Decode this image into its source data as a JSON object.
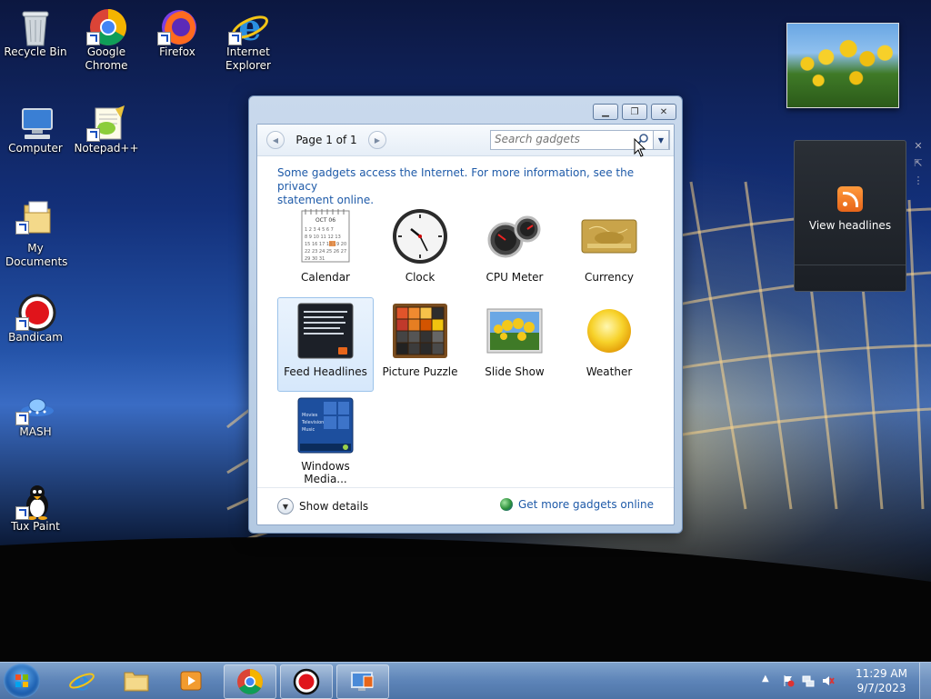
{
  "desktop": {
    "icons": [
      {
        "label": "Recycle Bin",
        "icon": "recycle-bin-icon"
      },
      {
        "label": "Google Chrome",
        "icon": "chrome-icon"
      },
      {
        "label": "Firefox",
        "icon": "firefox-icon"
      },
      {
        "label": "Internet Explorer",
        "icon": "internet-explorer-icon"
      },
      {
        "label": "Computer",
        "icon": "computer-icon"
      },
      {
        "label": "Notepad++",
        "icon": "notepad-plus-plus-icon"
      },
      {
        "label": "My Documents",
        "icon": "folder-icon"
      },
      {
        "label": "Bandicam",
        "icon": "bandicam-icon"
      },
      {
        "label": "MASH",
        "icon": "mash-icon"
      },
      {
        "label": "Tux Paint",
        "icon": "tux-paint-icon"
      }
    ]
  },
  "gadget_window": {
    "pager": {
      "text": "Page 1 of 1"
    },
    "search": {
      "placeholder": "Search gadgets"
    },
    "info_line1": "Some gadgets access the Internet.  For more information, see the privacy",
    "info_line2": "statement online.",
    "gadgets": [
      {
        "label": "Calendar",
        "icon": "calendar-icon"
      },
      {
        "label": "Clock",
        "icon": "clock-icon"
      },
      {
        "label": "CPU Meter",
        "icon": "cpu-meter-icon"
      },
      {
        "label": "Currency",
        "icon": "currency-icon"
      },
      {
        "label": "Feed Headlines",
        "icon": "feed-headlines-icon",
        "selected": true
      },
      {
        "label": "Picture Puzzle",
        "icon": "picture-puzzle-icon"
      },
      {
        "label": "Slide Show",
        "icon": "slide-show-icon"
      },
      {
        "label": "Weather",
        "icon": "weather-icon"
      },
      {
        "label": "Windows Media...",
        "icon": "windows-media-center-icon"
      }
    ],
    "calendar_month": "OCT 06",
    "media_center_items": [
      "Movies",
      "Television",
      "Music"
    ],
    "footer": {
      "show_details": "Show details",
      "get_more": "Get more gadgets online"
    }
  },
  "feed_gadget": {
    "label": "View headlines"
  },
  "taskbar": {
    "buttons": [
      {
        "icon": "internet-explorer-icon"
      },
      {
        "icon": "file-explorer-icon"
      },
      {
        "icon": "media-player-icon"
      },
      {
        "icon": "chrome-icon"
      },
      {
        "icon": "bandicam-icon"
      },
      {
        "icon": "gadgets-icon"
      }
    ],
    "clock": {
      "time": "11:29 AM",
      "date": "9/7/2023"
    }
  },
  "colors": {
    "link_blue": "#1e5aa8",
    "selection_bg": "#d6e8fb",
    "taskbar": "#5d84b8",
    "feed_orange": "#e7651a"
  }
}
